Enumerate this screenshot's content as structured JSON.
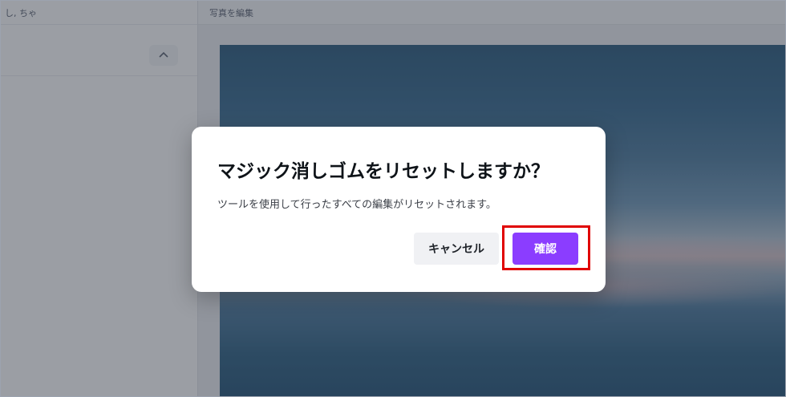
{
  "sidebar": {
    "top_label": "し, ちゃ"
  },
  "topbar": {
    "label": "写真を編集"
  },
  "dialog": {
    "title": "マジック消しゴムをリセットしますか？",
    "body": "ツールを使用して行ったすべての編集がリセットされます。",
    "cancel_label": "キャンセル",
    "confirm_label": "確認"
  },
  "colors": {
    "accent": "#8b3dff",
    "highlight": "#e00000"
  },
  "icons": {
    "collapse": "chevron-up-icon"
  }
}
